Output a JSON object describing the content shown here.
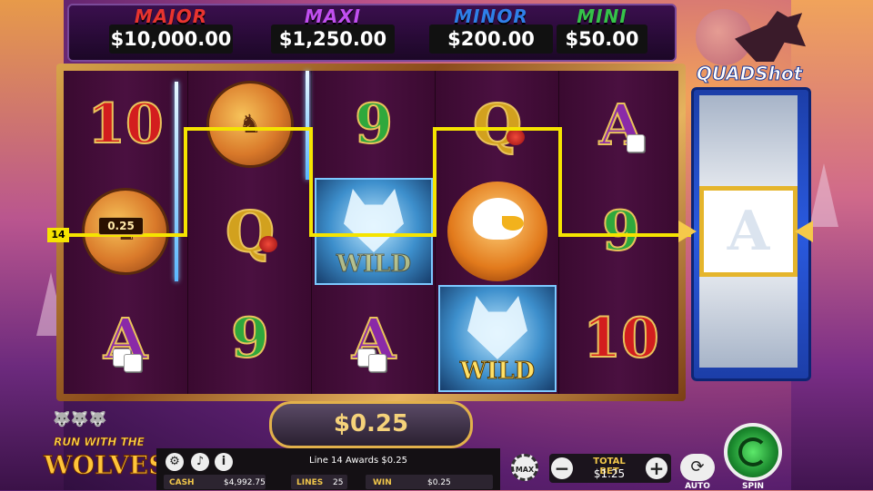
{
  "jackpots": [
    {
      "name": "MAJOR",
      "value": "$10,000.00",
      "color": "#e8342f"
    },
    {
      "name": "MAXI",
      "value": "$1,250.00",
      "color": "#c14ff0"
    },
    {
      "name": "MINOR",
      "value": "$200.00",
      "color": "#2f7fe8"
    },
    {
      "name": "MINI",
      "value": "$50.00",
      "color": "#36c24a"
    }
  ],
  "reels": {
    "col1": [
      "10",
      "medallion-deer",
      "A"
    ],
    "col2": [
      "medallion-deer",
      "Q",
      "9"
    ],
    "col3": [
      "9",
      "WILD",
      "A"
    ],
    "col4": [
      "Q",
      "eagle",
      "WILD"
    ],
    "col5": [
      "A",
      "9",
      "10"
    ]
  },
  "symbols": {
    "ten": "10",
    "nine": "9",
    "ace": "A",
    "queen": "Q",
    "wild": "WILD"
  },
  "payline": {
    "number": "14",
    "value": "0.25",
    "color": "#f5e400"
  },
  "quadshot": {
    "logo": "QUADShot",
    "symbol": "A"
  },
  "win_display": "$0.25",
  "brand": {
    "line1": "RUN WITH THE",
    "line2": "WOLVES"
  },
  "bottom": {
    "award_text": "Line 14 Awards $0.25",
    "cash_label": "CASH",
    "cash_value": "$4,992.75",
    "lines_label": "LINES",
    "lines_value": "25",
    "win_label": "WIN",
    "win_value": "$0.25",
    "settings_icon": "gear-icon",
    "sound_icon": "sound-icon",
    "info_icon": "info-icon",
    "info_glyph": "i"
  },
  "bet": {
    "max_label": "MAX",
    "total_bet_label": "TOTAL BET",
    "total_bet_value": "$1.25",
    "minus": "−",
    "plus": "+"
  },
  "controls": {
    "auto_label": "AUTO",
    "spin_label": "SPIN"
  }
}
